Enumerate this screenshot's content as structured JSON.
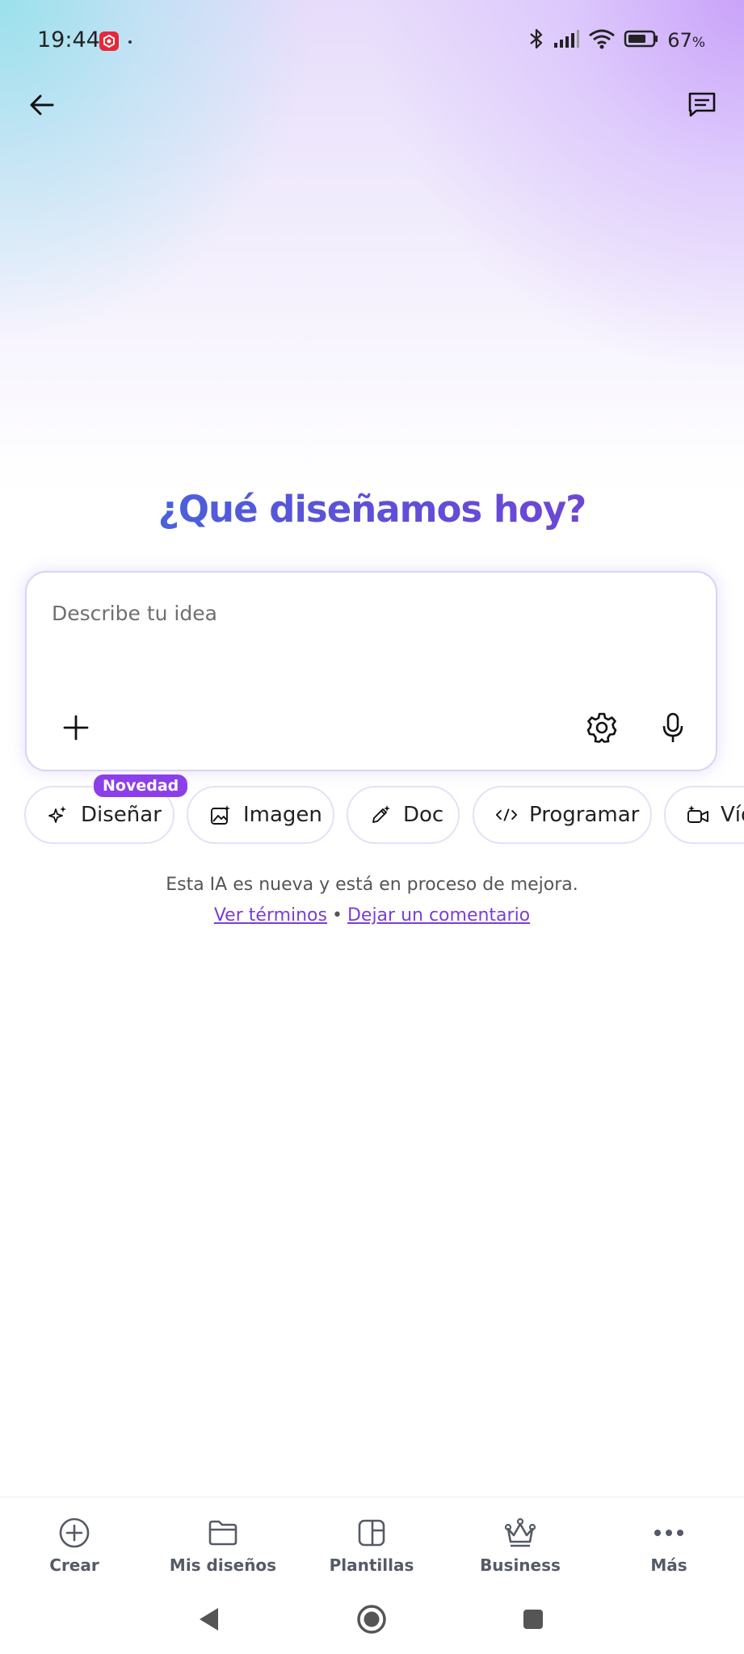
{
  "status_bar": {
    "time": "19:44",
    "battery_percent": "67",
    "battery_unit": "%"
  },
  "header": {
    "back_icon": "arrow-left-icon",
    "feedback_icon": "message-icon"
  },
  "main": {
    "headline": "¿Qué diseñamos hoy?",
    "prompt": {
      "placeholder": "Describe tu idea",
      "value": ""
    },
    "badge": "Novedad",
    "chips": [
      {
        "label": "Diseñar",
        "icon": "sparkles-icon"
      },
      {
        "label": "Imagen",
        "icon": "image-sparkle-icon"
      },
      {
        "label": "Doc",
        "icon": "pen-sparkle-icon"
      },
      {
        "label": "Programar",
        "icon": "code-icon"
      },
      {
        "label": "Víd",
        "icon": "video-sparkle-icon"
      }
    ],
    "disclaimer": "Esta IA es nueva y está en proceso de mejora.",
    "terms_link": "Ver términos",
    "separator": "•",
    "feedback_link": "Dejar un comentario"
  },
  "bottom_nav": [
    {
      "label": "Crear",
      "icon": "plus-circle-icon"
    },
    {
      "label": "Mis diseños",
      "icon": "folder-icon"
    },
    {
      "label": "Plantillas",
      "icon": "template-icon"
    },
    {
      "label": "Business",
      "icon": "crown-icon"
    },
    {
      "label": "Más",
      "icon": "more-icon"
    }
  ],
  "colors": {
    "accent": "#7a3fd4",
    "badge": "#8b3fe8",
    "headline_start": "#3b6ee0",
    "headline_end": "#7a3fd4"
  }
}
